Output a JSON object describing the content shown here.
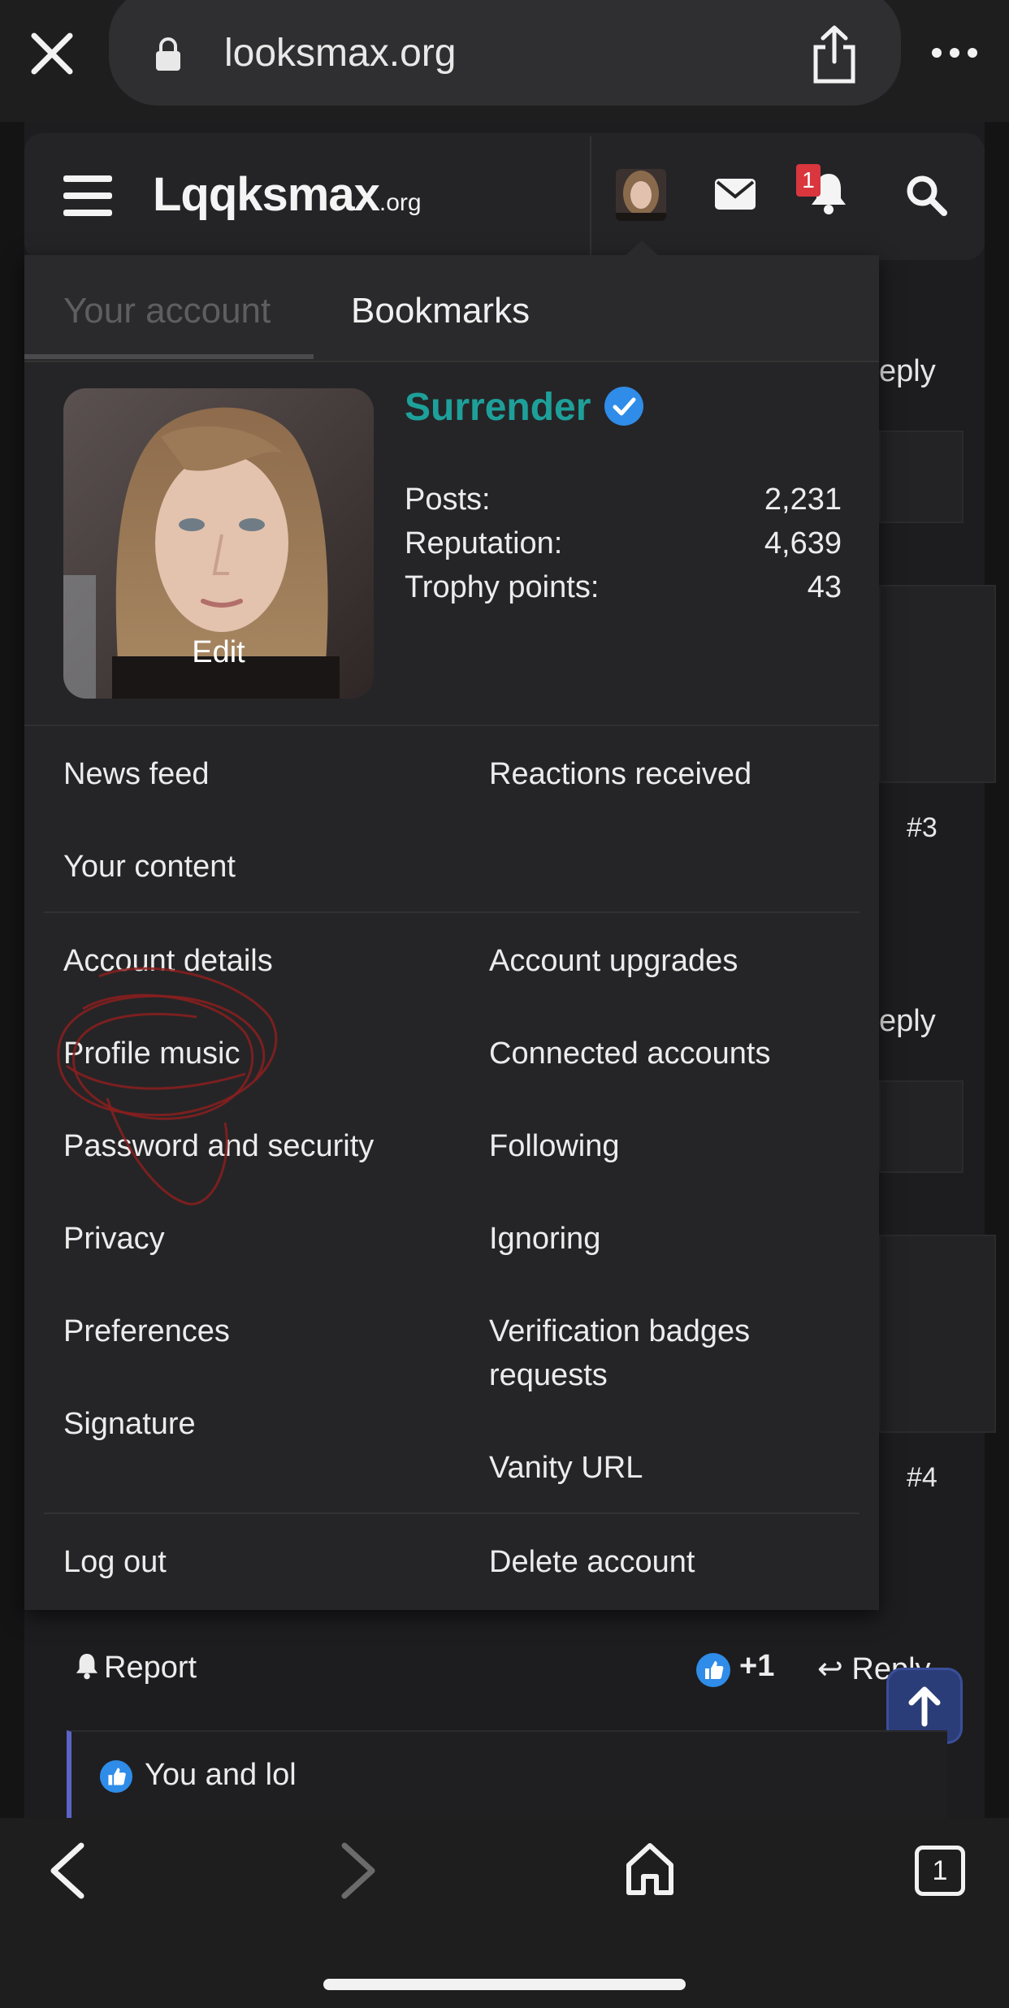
{
  "browser": {
    "url": "looksmax.org",
    "tab_count": "1"
  },
  "header": {
    "logo_main": "Lqqksmax",
    "logo_suffix": ".org",
    "notification_count": "1"
  },
  "menu": {
    "tabs": [
      {
        "label": "Your account",
        "active": true
      },
      {
        "label": "Bookmarks",
        "active": false
      }
    ],
    "profile": {
      "edit_label": "Edit",
      "username": "Surrender",
      "verified": true,
      "stats": [
        {
          "label": "Posts:",
          "value": "2,231"
        },
        {
          "label": "Reputation:",
          "value": "4,639"
        },
        {
          "label": "Trophy points:",
          "value": "43"
        }
      ]
    },
    "section1": {
      "left": [
        "News feed",
        "Your content"
      ],
      "right": [
        "Reactions received"
      ]
    },
    "section2": {
      "left": [
        "Account details",
        "Profile music",
        "Password and security",
        "Privacy",
        "Preferences",
        "Signature"
      ],
      "right": [
        "Account upgrades",
        "Connected accounts",
        "Following",
        "Ignoring",
        "Verification badges requests",
        "Vanity URL"
      ]
    },
    "section3": {
      "left": [
        "Log out"
      ],
      "right": [
        "Delete account"
      ]
    }
  },
  "background_page": {
    "reply_partial": "eply",
    "post_numbers": [
      "#3",
      "#4"
    ]
  },
  "post": {
    "report_label": "Report",
    "like_count": "+1",
    "reply_label": "Reply",
    "reactions_text": "You and lol"
  },
  "colors": {
    "username": "#1ea09a",
    "verified": "#2f8ce8",
    "badge": "#d9363e",
    "scroll_button": "#2b3d78",
    "annotation_scribble": "#8b1e1e"
  }
}
